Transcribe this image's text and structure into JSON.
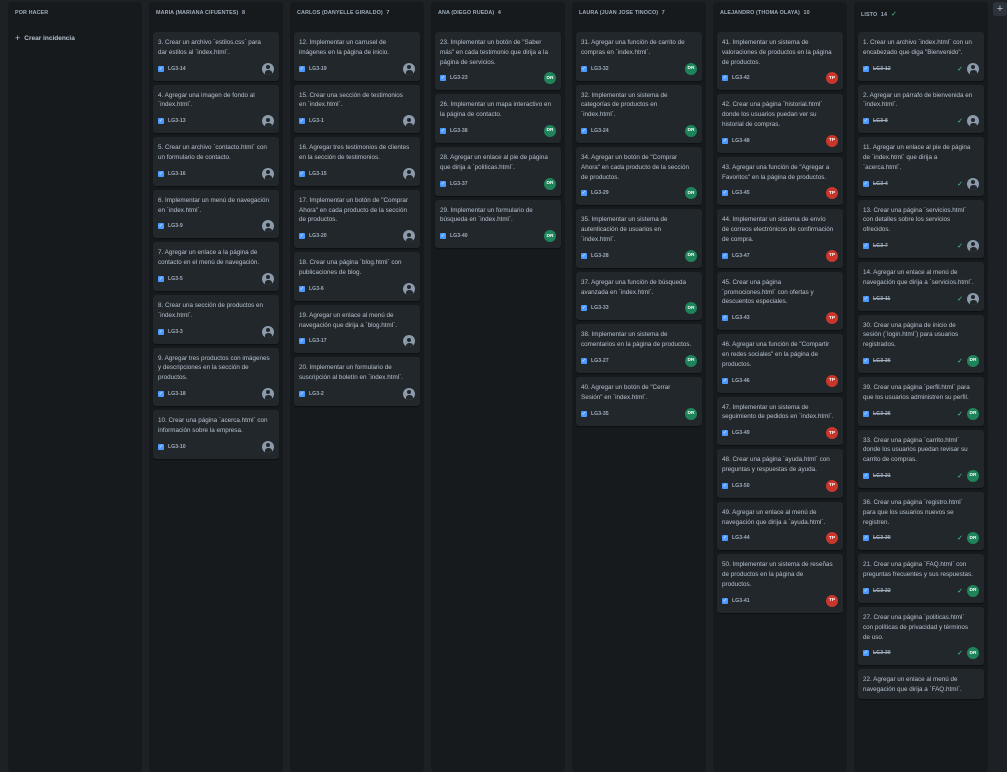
{
  "board": {
    "create_label": "Crear incidencia",
    "add_column_symbol": "+",
    "columns": [
      {
        "title": "POR HACER",
        "count": "",
        "cards": []
      },
      {
        "title": "MARIA (MARIANA CIFUENTES)",
        "count": "8",
        "cards": [
          {
            "title": "3. Crear un archivo `estilos.css` para dar estilos al `index.html`.",
            "key": "LG3-14",
            "avatar": null
          },
          {
            "title": "4. Agregar una imagen de fondo al `index.html`.",
            "key": "LG3-13",
            "avatar": null
          },
          {
            "title": "5. Crear un archivo `contacto.html` con un formulario de contacto.",
            "key": "LG3-16",
            "avatar": null
          },
          {
            "title": "6. Implementar un menú de navegación en `index.html`.",
            "key": "LG3-9",
            "avatar": null
          },
          {
            "title": "7. Agregar un enlace a la página de contacto en el menú de navegación.",
            "key": "LG3-5",
            "avatar": null
          },
          {
            "title": "8. Crear una sección de productos en `index.html`.",
            "key": "LG3-3",
            "avatar": null
          },
          {
            "title": "9. Agregar tres productos con imágenes y descripciones en la sección de productos.",
            "key": "LG3-18",
            "avatar": null
          },
          {
            "title": "10. Crear una página `acerca.html` con información sobre la empresa.",
            "key": "LG3-10",
            "avatar": null
          }
        ]
      },
      {
        "title": "CARLOS (DANYELLE GIRALDO)",
        "count": "7",
        "cards": [
          {
            "title": "12. Implementar un carrusel de imágenes en la página de inicio.",
            "key": "LG3-19",
            "avatar": null
          },
          {
            "title": "15. Crear una sección de testimonios en `index.html`.",
            "key": "LG3-1",
            "avatar": null
          },
          {
            "title": "16. Agregar tres testimonios de clientes en la sección de testimonios.",
            "key": "LG3-15",
            "avatar": null
          },
          {
            "title": "17. Implementar un botón de \"Comprar Ahora\" en cada producto de la sección de productos.",
            "key": "LG3-20",
            "avatar": null
          },
          {
            "title": "18. Crear una página `blog.html` con publicaciones de blog.",
            "key": "LG3-6",
            "avatar": null
          },
          {
            "title": "19. Agregar un enlace al menú de navegación que dirija a `blog.html`.",
            "key": "LG3-17",
            "avatar": null
          },
          {
            "title": "20. Implementar un formulario de suscripción al boletín en `index.html`.",
            "key": "LG3-2",
            "avatar": null
          }
        ]
      },
      {
        "title": "ANA (DIEGO RUEDA)",
        "count": "4",
        "cards": [
          {
            "title": "23. Implementar un botón de \"Saber más\" en cada testimonio que dirija a la página de servicios.",
            "key": "LG3-23",
            "avatar": "DR"
          },
          {
            "title": "26. Implementar un mapa interactivo en la página de contacto.",
            "key": "LG3-38",
            "avatar": "DR"
          },
          {
            "title": "28. Agregar un enlace al pie de página que dirija a `politicas.html`.",
            "key": "LG3-37",
            "avatar": "DR"
          },
          {
            "title": "29. Implementar un formulario de búsqueda en `index.html`.",
            "key": "LG3-40",
            "avatar": "DR"
          }
        ]
      },
      {
        "title": "LAURA (JUAN JOSE TINOCO)",
        "count": "7",
        "cards": [
          {
            "title": "31. Agregar una función de carrito de compras en `index.html`.",
            "key": "LG3-32",
            "avatar": "DR"
          },
          {
            "title": "32. Implementar un sistema de categorías de productos en `index.html`.",
            "key": "LG3-24",
            "avatar": "DR"
          },
          {
            "title": "34. Agregar un botón de \"Comprar Ahora\" en cada producto de la sección de productos.",
            "key": "LG3-29",
            "avatar": "DR"
          },
          {
            "title": "35. Implementar un sistema de autenticación de usuarios en `index.html`.",
            "key": "LG3-28",
            "avatar": "DR"
          },
          {
            "title": "37. Agregar una función de búsqueda avanzada en `index.html`.",
            "key": "LG3-33",
            "avatar": "DR"
          },
          {
            "title": "38. Implementar un sistema de comentarios en la página de productos.",
            "key": "LG3-27",
            "avatar": "DR"
          },
          {
            "title": "40. Agregar un botón de \"Cerrar Sesión\" en `index.html`.",
            "key": "LG3-35",
            "avatar": "DR"
          }
        ]
      },
      {
        "title": "ALEJANDRO (THOMA OLAYA)",
        "count": "10",
        "cards": [
          {
            "title": "41. Implementar un sistema de valoraciones de productos en la página de productos.",
            "key": "LG3-42",
            "avatar": "TP"
          },
          {
            "title": "42. Crear una página `historial.html` donde los usuarios puedan ver su historial de compras.",
            "key": "LG3-48",
            "avatar": "TP"
          },
          {
            "title": "43. Agregar una función de \"Agregar a Favoritos\" en la página de productos.",
            "key": "LG3-45",
            "avatar": "TP"
          },
          {
            "title": "44. Implementar un sistema de envío de correos electrónicos de confirmación de compra.",
            "key": "LG3-47",
            "avatar": "TP"
          },
          {
            "title": "45. Crear una página `promociones.html` con ofertas y descuentos especiales.",
            "key": "LG3-43",
            "avatar": "TP"
          },
          {
            "title": "46. Agregar una función de \"Compartir en redes sociales\" en la página de productos.",
            "key": "LG3-46",
            "avatar": "TP"
          },
          {
            "title": "47. Implementar un sistema de seguimiento de pedidos en `index.html`.",
            "key": "LG3-49",
            "avatar": "TP"
          },
          {
            "title": "48. Crear una página `ayuda.html` con preguntas y respuestas de ayuda.",
            "key": "LG3-50",
            "avatar": "TP"
          },
          {
            "title": "49. Agregar un enlace al menú de navegación que dirija a `ayuda.html`.",
            "key": "LG3-44",
            "avatar": "TP"
          },
          {
            "title": "50. Implementar un sistema de reseñas de productos en la página de productos.",
            "key": "LG3-41",
            "avatar": "TP"
          }
        ]
      },
      {
        "title": "LISTO",
        "count": "14",
        "done": true,
        "cards": [
          {
            "title": "1. Crear un archivo `index.html` con un encabezado que diga \"Bienvenido\".",
            "key": "LG3-12",
            "avatar": null,
            "done": true
          },
          {
            "title": "2. Agregar un párrafo de bienvenida en `index.html`.",
            "key": "LG3-8",
            "avatar": null,
            "done": true
          },
          {
            "title": "11. Agregar un enlace al pie de página de `index.html` que dirija a `acerca.html`.",
            "key": "LG3-4",
            "avatar": null,
            "done": true
          },
          {
            "title": "13. Crear una página `servicios.html` con detalles sobre los servicios ofrecidos.",
            "key": "LG3-7",
            "avatar": null,
            "done": true
          },
          {
            "title": "14. Agregar un enlace al menú de navegación que dirija a `servicios.html`.",
            "key": "LG3-11",
            "avatar": null,
            "done": true
          },
          {
            "title": "30. Crear una página de inicio de sesión (`login.html`) para usuarios registrados.",
            "key": "LG3-36",
            "avatar": "DR",
            "done": true
          },
          {
            "title": "39. Crear una página `perfil.html` para que los usuarios administren su perfil.",
            "key": "LG3-26",
            "avatar": "DR",
            "done": true
          },
          {
            "title": "33. Crear una página `carrito.html` donde los usuarios puedan revisar su carrito de compras.",
            "key": "LG3-21",
            "avatar": "DR",
            "done": true
          },
          {
            "title": "36. Crear una página `registro.html` para que los usuarios nuevos se registren.",
            "key": "LG3-39",
            "avatar": "DR",
            "done": true
          },
          {
            "title": "21. Crear una página `FAQ.html` con preguntas frecuentes y sus respuestas.",
            "key": "LG3-22",
            "avatar": "DR",
            "done": true
          },
          {
            "title": "27. Crear una página `politicas.html` con políticas de privacidad y términos de uso.",
            "key": "LG3-30",
            "avatar": "DR",
            "done": true
          },
          {
            "title": "22. Agregar un enlace al menú de navegación que dirija a `FAQ.html`.",
            "key": "",
            "avatar": null,
            "done": true
          }
        ]
      }
    ]
  },
  "colors": {
    "background": "#1d2125",
    "column": "#161a1d",
    "card": "#22272b",
    "type_icon": "#4c9aff",
    "avatar_DR": "#1f845a",
    "avatar_TP": "#c9372c",
    "done_check": "#4bce97"
  },
  "icons": {
    "type": "checkbox-task-icon",
    "unassigned": "user-placeholder-icon",
    "done": "check-icon",
    "add": "plus-icon"
  }
}
